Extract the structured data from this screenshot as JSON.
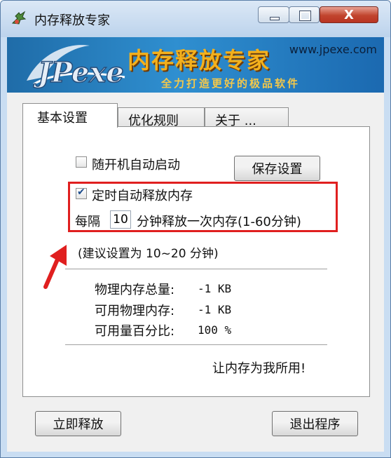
{
  "window": {
    "title": "内存释放专家",
    "close_glyph": "X"
  },
  "banner": {
    "logo": "JPexe",
    "title": "内存释放专家",
    "url": "www.jpexe.com",
    "slogan": "全力打造更好的极品软件"
  },
  "tabs": [
    {
      "label": "基本设置",
      "active": true
    },
    {
      "label": "优化规则",
      "active": false
    },
    {
      "label": "关于 ...",
      "active": false
    }
  ],
  "settings": {
    "autostart_label": "随开机自动启动",
    "autostart_checked": false,
    "save_button": "保存设置",
    "timed_release_label": "定时自动释放内存",
    "timed_release_checked": true,
    "interval_prefix": "每隔",
    "interval_value": "10",
    "interval_suffix": "分钟释放一次内存(1-60分钟)",
    "suggestion": "(建议设置为 10~20 分钟)"
  },
  "memory": {
    "total_label": "物理内存总量:",
    "total_value": "-1 KB",
    "available_label": "可用物理内存:",
    "available_value": "-1 KB",
    "percent_label": "可用量百分比:",
    "percent_value": "100 %"
  },
  "tagline": "让内存为我所用!",
  "footer": {
    "release_button": "立即释放",
    "exit_button": "退出程序"
  },
  "colors": {
    "annotation_red": "#e01f1f",
    "banner_blue": "#2f8fd0",
    "banner_gold": "#f4b01c"
  }
}
